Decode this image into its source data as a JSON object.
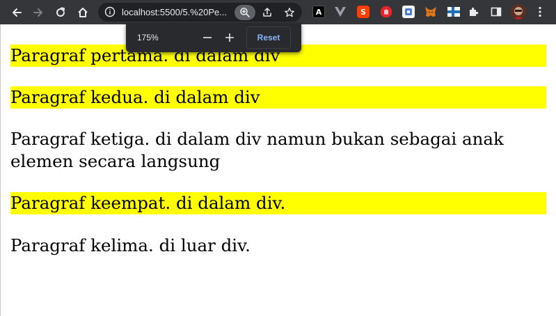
{
  "browser": {
    "url": "localhost:5500/5.%20Pe...",
    "url_host": "localhost",
    "zoom_popup": {
      "level": "175%",
      "reset_label": "Reset"
    },
    "extensions": [
      {
        "name": "angular-extension-icon",
        "glyph": "A",
        "color": "#000000"
      },
      {
        "name": "vue-devtools-icon",
        "glyph": "V",
        "color": "#9aa0a6"
      },
      {
        "name": "svelte-extension-icon",
        "glyph": "S",
        "color": "#ff3e00"
      },
      {
        "name": "adblock-extension-icon",
        "glyph": "✋",
        "color": "#e4262c"
      },
      {
        "name": "blue-extension-icon",
        "glyph": "B",
        "color": "#4a7bd6"
      },
      {
        "name": "metamask-fox-icon",
        "glyph": "🦊",
        "color": "#e2761b"
      },
      {
        "name": "flag-extension-icon",
        "glyph": "+",
        "color": "#1e6fb9"
      }
    ],
    "colors": {
      "toolbar": "#35363a",
      "omnibox": "#202124",
      "popup": "#292a2d",
      "link_blue": "#8ab4f8",
      "highlight": "#ffff00"
    }
  },
  "content": {
    "paragraphs": [
      {
        "text": "Paragraf pertama. di dalam div",
        "highlighted": true
      },
      {
        "text": "Paragraf kedua. di dalam div",
        "highlighted": true
      },
      {
        "text": "Paragraf ketiga. di dalam div namun bukan sebagai anak elemen secara langsung",
        "highlighted": false
      },
      {
        "text": "Paragraf keempat. di dalam div.",
        "highlighted": true
      },
      {
        "text": "Paragraf kelima. di luar div.",
        "highlighted": false
      }
    ]
  }
}
